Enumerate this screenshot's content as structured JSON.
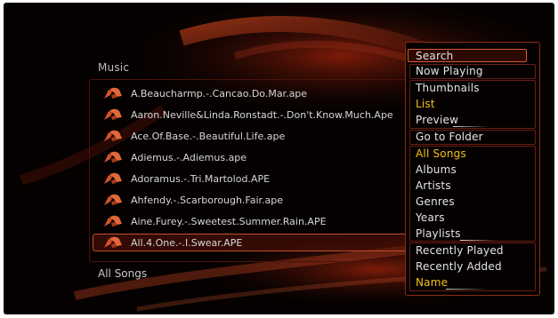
{
  "section_title": "Music",
  "footer_label": "All Songs",
  "files": [
    {
      "name": "A.Beaucharmp.-.Cancao.Do.Mar.ape"
    },
    {
      "name": "Aaron.Neville&Linda.Ronstadt.-.Don't.Know.Much.Ape"
    },
    {
      "name": "Ace.Of.Base.-.Beautiful.Life.ape"
    },
    {
      "name": "Adiemus.-.Adiemus.ape"
    },
    {
      "name": "Adoramus.-.Tri.Martolod.APE"
    },
    {
      "name": "Ahfendy.-.Scarborough.Fair.ape"
    },
    {
      "name": "Aine.Furey.-.Sweetest.Summer.Rain.APE"
    },
    {
      "name": "All.4.One.-.I.Swear.APE"
    }
  ],
  "selected_file_index": 7,
  "menu": {
    "search": "Search",
    "now_playing": "Now Playing",
    "thumbnails": "Thumbnails",
    "list": "List",
    "preview": "Preview",
    "go_to_folder": "Go to Folder",
    "all_songs": "All Songs",
    "albums": "Albums",
    "artists": "Artists",
    "genres": "Genres",
    "years": "Years",
    "playlists": "Playlists",
    "recently_played": "Recently Played",
    "recently_added": "Recently Added",
    "name": "Name"
  },
  "colors": {
    "background": "#050101",
    "accent_red": "#d85a30",
    "active_yellow": "#f5c11a",
    "text": "#d7d7d7"
  },
  "icons": {
    "file_icon": "music-note-icon"
  }
}
